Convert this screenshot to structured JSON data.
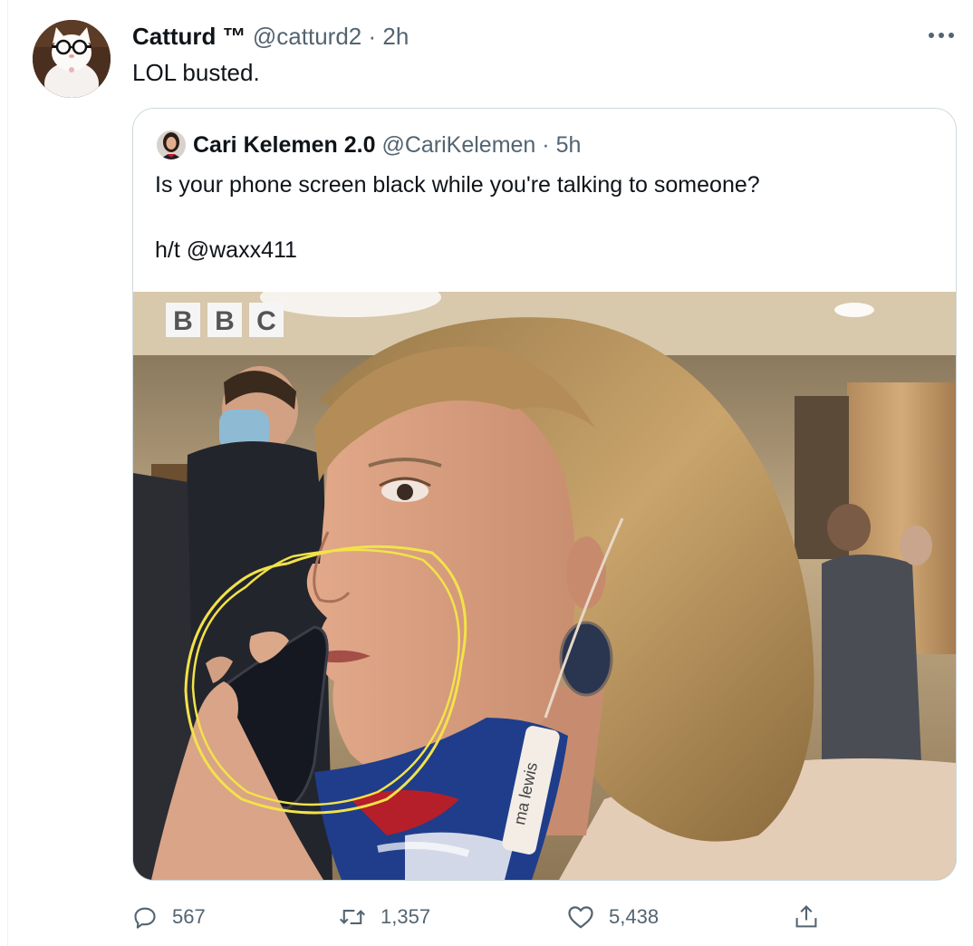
{
  "tweet": {
    "author_name": "Catturd ™",
    "author_handle": "@catturd2",
    "separator": "·",
    "time": "2h",
    "text": "LOL busted."
  },
  "quoted": {
    "author_name": "Cari Kelemen 2.0",
    "author_handle": "@CariKelemen",
    "separator": "·",
    "time": "5h",
    "text_line1": "Is your phone screen black while you're talking to someone?",
    "text_line2": "h/t @waxx411",
    "media": {
      "watermark_letters": [
        "B",
        "B",
        "C"
      ],
      "mask_label": "ma lewis"
    }
  },
  "actions": {
    "replies": "567",
    "retweets": "1,357",
    "likes": "5,438"
  },
  "colors": {
    "text": "#0f1419",
    "muted": "#536471",
    "border": "#cfd9de",
    "annotation": "#f2e24a"
  },
  "icons": [
    "more-icon",
    "reply-icon",
    "retweet-icon",
    "like-icon",
    "share-icon"
  ]
}
